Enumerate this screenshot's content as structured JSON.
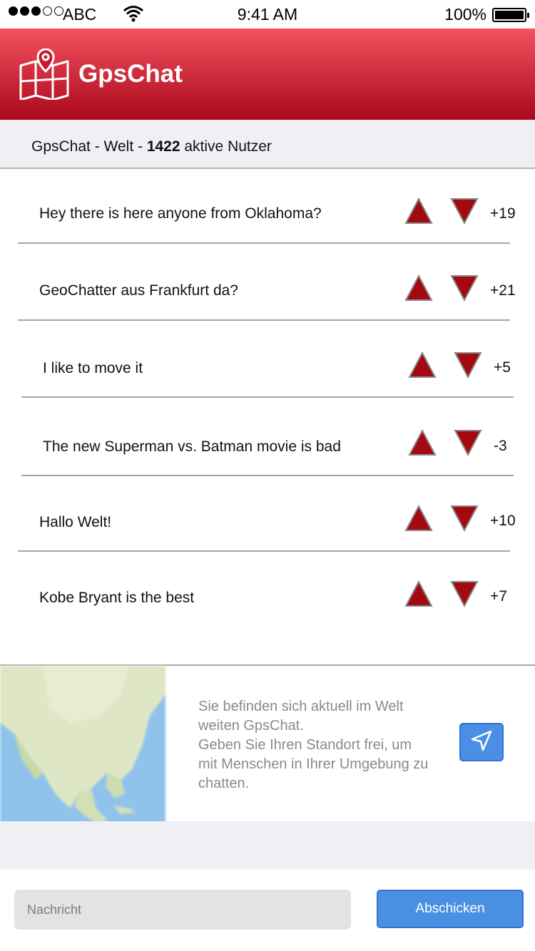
{
  "status_bar": {
    "carrier": "ABC",
    "time": "9:41 AM",
    "battery": "100%",
    "signal_bars_filled": 3,
    "signal_bars_total": 5
  },
  "header": {
    "title": "GpsChat",
    "logo_icon": "map-pin-icon",
    "background": "#c41a2e"
  },
  "subheader": {
    "prefix": "GpsChat - Welt - ",
    "user_count": "1422",
    "suffix": " aktive Nutzer"
  },
  "messages": [
    {
      "text": "Hey there is here anyone from Oklahoma?",
      "score": "+19"
    },
    {
      "text": "GeoChatter aus Frankfurt da?",
      "score": "+21"
    },
    {
      "text": "I like to move it",
      "score": "+5"
    },
    {
      "text": "The new Superman vs. Batman movie is bad",
      "score": "-3"
    },
    {
      "text": "Hallo Welt!",
      "score": "+10"
    },
    {
      "text": "Kobe Bryant is the best",
      "score": "+7"
    }
  ],
  "vote": {
    "up_icon": "triangle-up-icon",
    "down_icon": "triangle-down-icon",
    "color": "#a30a0f"
  },
  "location": {
    "line1": "Sie befinden sich aktuell im Welt weiten GpsChat.",
    "line2": "Geben Sie Ihren Standort frei, um mit Menschen in Ihrer Umgebung zu chatten.",
    "button_icon": "location-arrow-icon",
    "map_icon": "map-thumbnail"
  },
  "composer": {
    "placeholder": "Nachricht",
    "value": "",
    "send_label": "Abschicken"
  },
  "colors": {
    "accent": "#4a90e2",
    "brand": "#c41a2e",
    "vote": "#a30a0f"
  }
}
